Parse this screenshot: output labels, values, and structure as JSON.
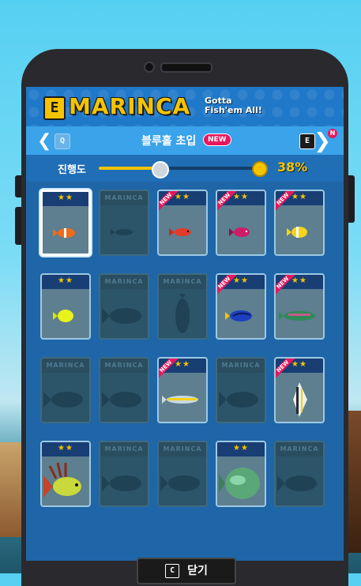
{
  "header": {
    "logo_mark": "E",
    "brand": "MARINCA",
    "tagline_1": "Gotta",
    "tagline_2": "Fish'em All!"
  },
  "stage": {
    "prev_key": "Q",
    "next_key": "E",
    "title": "블루홀 초입",
    "new_badge": "NEW",
    "notify": "N"
  },
  "progress": {
    "label": "진행도",
    "percent_text": "38%",
    "value": 0.38
  },
  "cards": [
    {
      "state": "unlocked",
      "stars": "★★",
      "new": false,
      "fish": "clownfish",
      "selected": true
    },
    {
      "state": "locked",
      "tag": "MARINCA",
      "fish": "small-shadow"
    },
    {
      "state": "unlocked",
      "stars": "★★",
      "new": true,
      "fish": "red-fish"
    },
    {
      "state": "unlocked",
      "stars": "★★",
      "new": true,
      "fish": "pink-fish"
    },
    {
      "state": "unlocked",
      "stars": "★★",
      "new": true,
      "fish": "yellow-fish"
    },
    {
      "state": "unlocked",
      "stars": "★★",
      "new": false,
      "fish": "yellow-tang"
    },
    {
      "state": "locked",
      "tag": "MARINCA",
      "fish": "big-shadow"
    },
    {
      "state": "locked",
      "tag": "MARINCA",
      "fish": "tall-shadow"
    },
    {
      "state": "unlocked",
      "stars": "★★",
      "new": true,
      "fish": "blue-tang"
    },
    {
      "state": "unlocked",
      "stars": "★★",
      "new": true,
      "fish": "green-wrasse"
    },
    {
      "state": "locked",
      "tag": "MARINCA",
      "fish": "big-shadow"
    },
    {
      "state": "locked",
      "tag": "MARINCA",
      "fish": "big-shadow"
    },
    {
      "state": "unlocked",
      "stars": "★★",
      "new": true,
      "fish": "long-fish"
    },
    {
      "state": "locked",
      "tag": "MARINCA",
      "fish": "big-shadow"
    },
    {
      "state": "unlocked",
      "stars": "★★",
      "new": true,
      "fish": "angelfish"
    },
    {
      "state": "unlocked",
      "stars": "★★",
      "new": false,
      "fish": "lionfish"
    },
    {
      "state": "locked",
      "tag": "MARINCA",
      "fish": "big-shadow"
    },
    {
      "state": "locked",
      "tag": "MARINCA",
      "fish": "big-shadow"
    },
    {
      "state": "unlocked",
      "stars": "★★",
      "new": false,
      "fish": "grouper"
    },
    {
      "state": "locked",
      "tag": "MARINCA",
      "fish": "big-shadow"
    }
  ],
  "footer": {
    "close_key": "C",
    "close_label": "닫기"
  }
}
